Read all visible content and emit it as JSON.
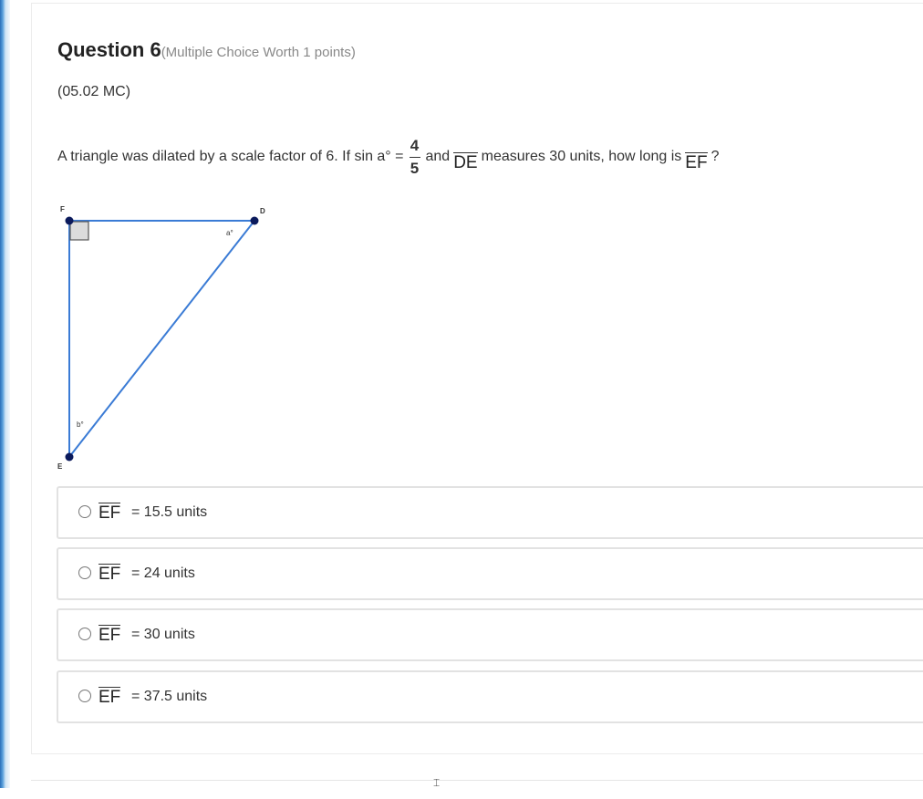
{
  "question": {
    "number_label": "Question 6",
    "meta": "(Multiple Choice Worth 1 points)",
    "code": "(05.02 MC)",
    "text": {
      "part1": "A triangle was dilated by a scale factor of 6. If sin a° =",
      "frac_num": "4",
      "frac_den": "5",
      "part2": "and",
      "seg1": "DE",
      "part3": "measures 30 units, how long is",
      "seg2": "EF",
      "part4": "?"
    }
  },
  "diagram": {
    "label_F": "F",
    "label_D": "D",
    "label_E": "E",
    "angle_a": "a°",
    "angle_b": "b°",
    "line_color": "#3a7bd5",
    "point_color": "#0b1a5c"
  },
  "choices": [
    {
      "segment": "EF",
      "value": "= 15.5 units",
      "selected": false
    },
    {
      "segment": "EF",
      "value": "= 24 units",
      "selected": false
    },
    {
      "segment": "EF",
      "value": "= 30 units",
      "selected": false
    },
    {
      "segment": "EF",
      "value": "= 37.5 units",
      "selected": false
    }
  ],
  "colors": {
    "accent": "#2a6fb8",
    "border": "#e2e2e2"
  }
}
